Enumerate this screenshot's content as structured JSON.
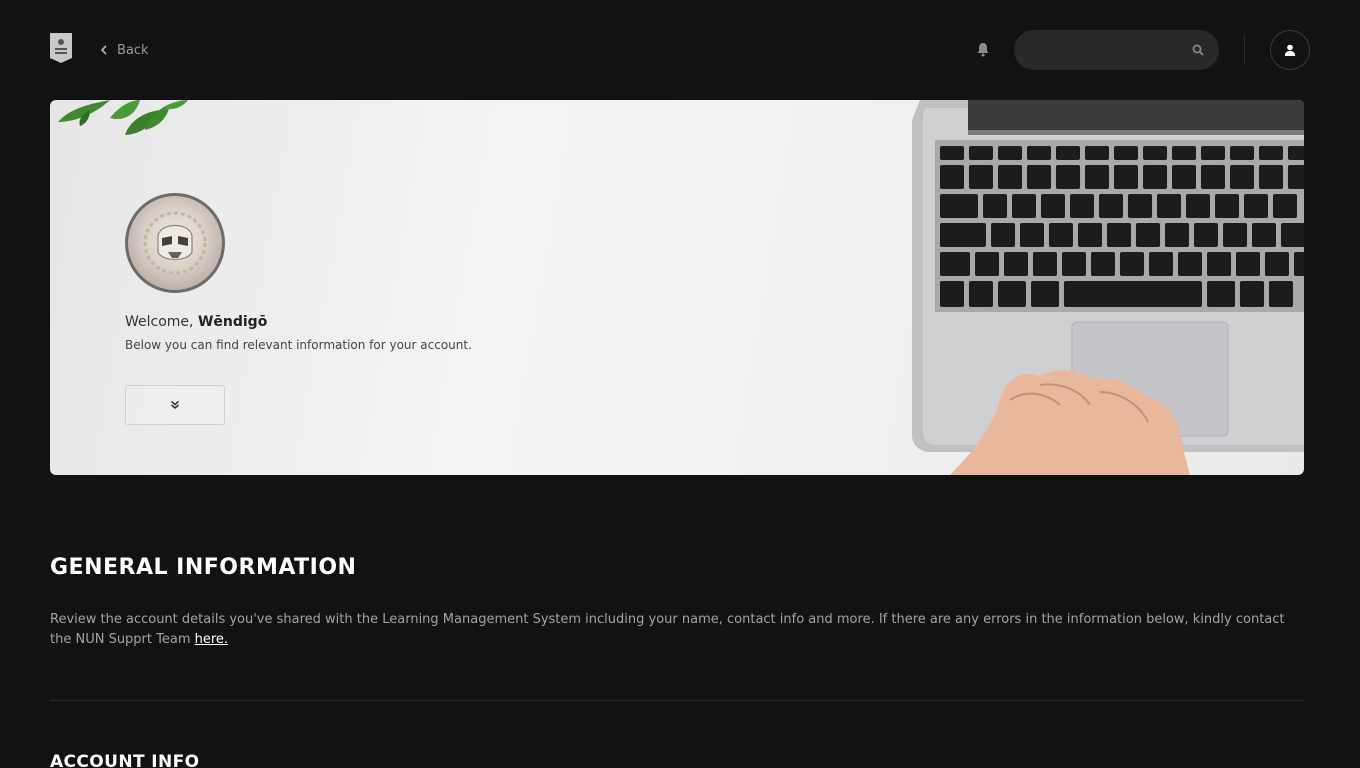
{
  "header": {
    "logo_icon": "shield-logo-icon",
    "back_label": "Back",
    "search": {
      "value": "",
      "placeholder": ""
    },
    "icons": [
      "chevron-left-icon",
      "bell-icon",
      "search-icon",
      "user-icon"
    ]
  },
  "hero": {
    "welcome_prefix": "Welcome, ",
    "user_name": "Wēndigō",
    "subtitle": "Below you can find relevant information for your account.",
    "expand_icon": "chevron-double-down-icon"
  },
  "general": {
    "title": "GENERAL INFORMATION",
    "description": "Review the account details you've shared with the Learning Management System including your name, contact info and more. If there are any errors in the information below, kindly contact the NUN Supprt Team ",
    "link_label": "here."
  },
  "account": {
    "title": "ACCOUNT INFO"
  },
  "colors": {
    "background": "#131213",
    "search_bg": "#2a292a",
    "muted_text": "#a3a3a3"
  }
}
